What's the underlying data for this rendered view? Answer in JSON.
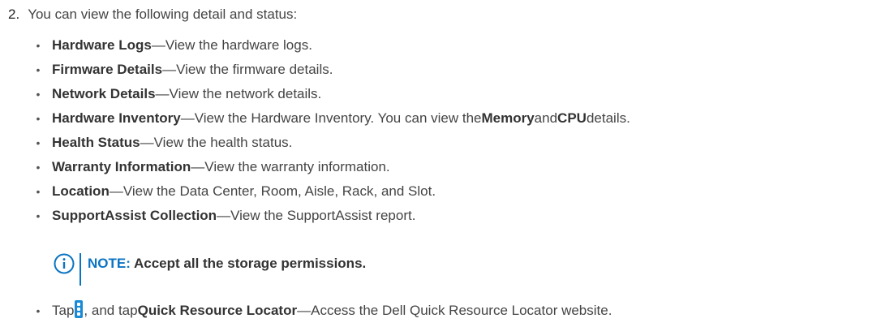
{
  "step": {
    "number": "2.",
    "text": "You can view the following detail and status:"
  },
  "items": [
    {
      "term": "Hardware Logs",
      "desc": "—View the hardware logs."
    },
    {
      "term": "Firmware Details",
      "desc": "—View the firmware details."
    },
    {
      "term": "Network Details",
      "desc": "—View the network details."
    },
    {
      "term": "Hardware Inventory",
      "desc": "—View the Hardware Inventory. You can view the ",
      "bold1": "Memory",
      "mid": " and ",
      "bold2": "CPU",
      "tail": " details."
    },
    {
      "term": "Health Status",
      "desc": "—View the health status."
    },
    {
      "term": "Warranty Information",
      "desc": "—View the warranty information."
    },
    {
      "term": "Location",
      "desc": "—View the Data Center, Room, Aisle, Rack, and Slot."
    },
    {
      "term": "SupportAssist Collection",
      "desc": "—View the SupportAssist report."
    }
  ],
  "note": {
    "label": "NOTE:",
    "text": " Accept all the storage permissions."
  },
  "last_item": {
    "pre": "Tap ",
    "icon": "kebab-menu-icon",
    "mid": ", and tap ",
    "term": "Quick Resource Locator",
    "desc": "—Access the Dell Quick Resource Locator website."
  },
  "colors": {
    "accent": "#0b74c2",
    "icon_fill": "#1a8ad4"
  }
}
